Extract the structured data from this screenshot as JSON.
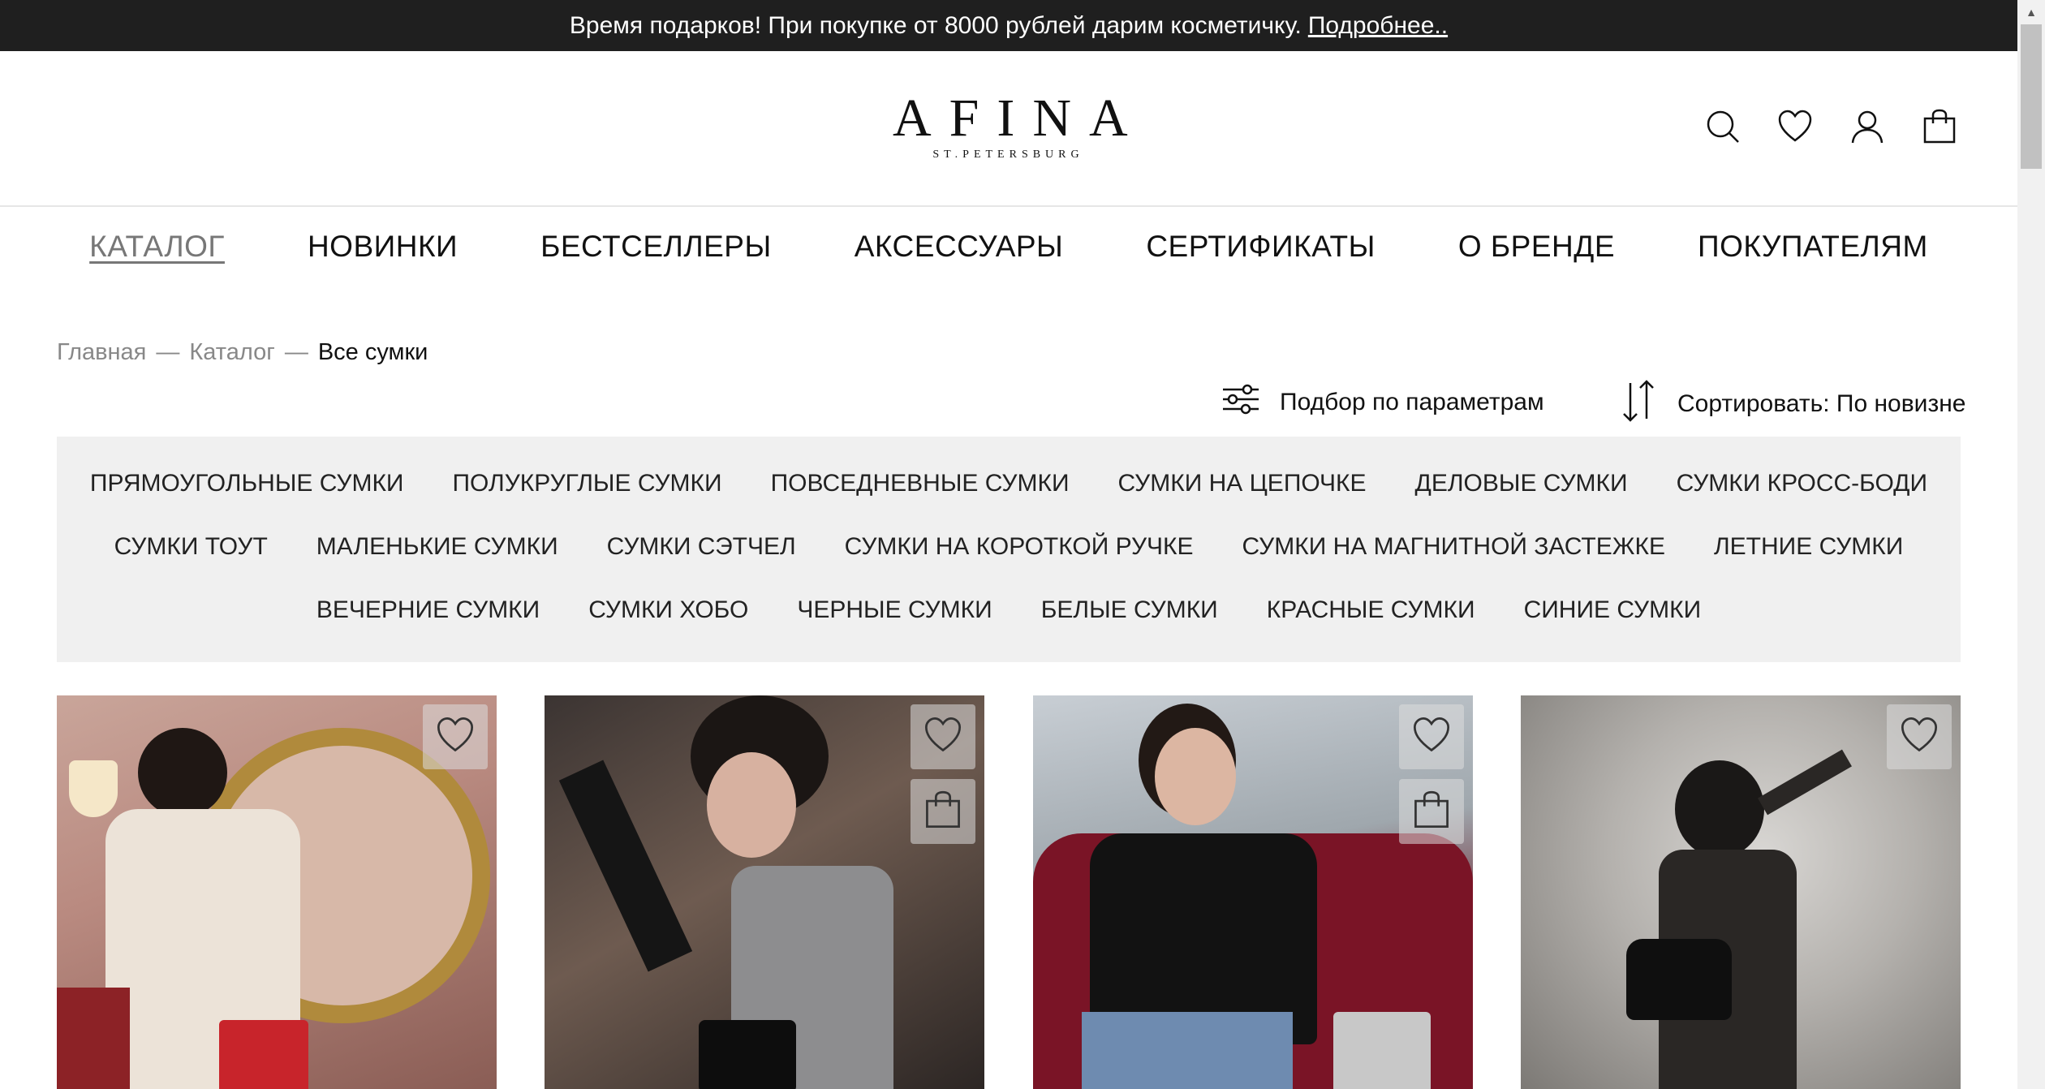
{
  "promo": {
    "text": "Время подарков! При покупке от 8000 рублей дарим косметичку.",
    "link": "Подробнее.."
  },
  "logo": {
    "main": "AFINA",
    "sub": "ST.PETERSBURG"
  },
  "header_icons": [
    "search-icon",
    "heart-icon",
    "user-icon",
    "bag-icon"
  ],
  "nav": [
    {
      "label": "КАТАЛОГ",
      "active": true
    },
    {
      "label": "НОВИНКИ"
    },
    {
      "label": "БЕСТСЕЛЛЕРЫ"
    },
    {
      "label": "АКСЕССУАРЫ"
    },
    {
      "label": "СЕРТИФИКАТЫ"
    },
    {
      "label": "О БРЕНДЕ"
    },
    {
      "label": "ПОКУПАТЕЛЯМ"
    }
  ],
  "breadcrumb": {
    "home": "Главная",
    "catalog": "Каталог",
    "current": "Все сумки",
    "separator": "—"
  },
  "toolbar": {
    "filter": "Подбор по параметрам",
    "sort": "Сортировать: По новизне"
  },
  "categories": {
    "row1": [
      "ПРЯМОУГОЛЬНЫЕ СУМКИ",
      "ПОЛУКРУГЛЫЕ СУМКИ",
      "ПОВСЕДНЕВНЫЕ СУМКИ",
      "СУМКИ НА ЦЕПОЧКЕ",
      "ДЕЛОВЫЕ СУМКИ",
      "СУМКИ КРОСС-БОДИ"
    ],
    "row2": [
      "СУМКИ ТОУТ",
      "МАЛЕНЬКИЕ СУМКИ",
      "СУМКИ СЭТЧЕЛ",
      "СУМКИ НА КОРОТКОЙ РУЧКЕ",
      "СУМКИ НА МАГНИТНОЙ ЗАСТЕЖКЕ",
      "ЛЕТНИЕ СУМКИ"
    ],
    "row3": [
      "ВЕЧЕРНИЕ СУМКИ",
      "СУМКИ ХОБО",
      "ЧЕРНЫЕ СУМКИ",
      "БЕЛЫЕ СУМКИ",
      "КРАСНЫЕ СУМКИ",
      "СИНИЕ СУМКИ"
    ]
  },
  "colors": {
    "promo_bg": "#1f1f1f",
    "panel_bg": "#f0f0f0",
    "active_nav": "#777777"
  }
}
